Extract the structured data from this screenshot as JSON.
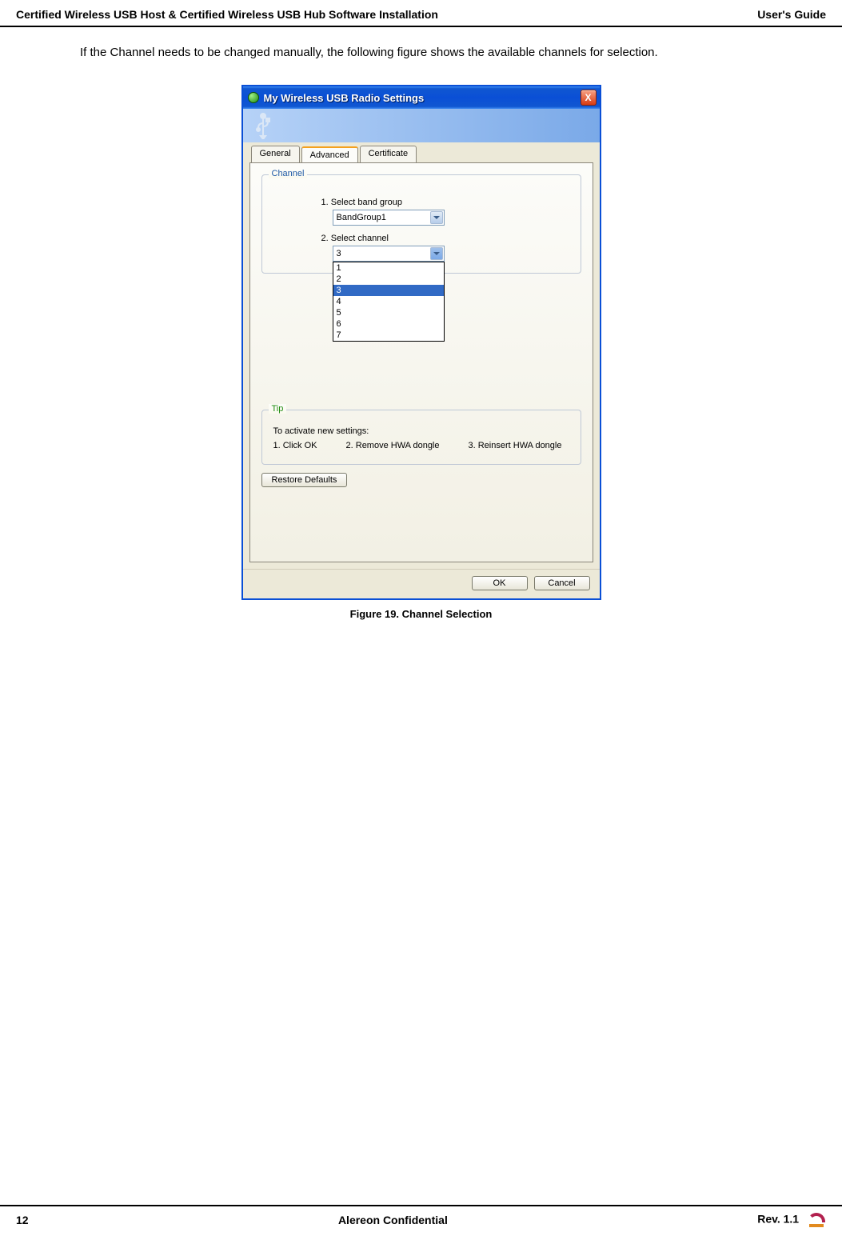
{
  "header": {
    "left": "Certified Wireless USB Host & Certified Wireless USB Hub Software Installation",
    "right": "User's Guide"
  },
  "body_text": "If the Channel needs to be changed manually, the following figure shows the available channels for selection.",
  "figure_caption": "Figure 19.    Channel Selection",
  "window": {
    "title": "My Wireless USB Radio Settings",
    "close_label": "X",
    "tabs": {
      "general": "General",
      "advanced": "Advanced",
      "certificate": "Certificate"
    },
    "channel_group": {
      "legend": "Channel",
      "band_label": "1. Select band group",
      "band_value": "BandGroup1",
      "channel_label": "2. Select channel",
      "channel_value": "3",
      "options": [
        "1",
        "2",
        "3",
        "4",
        "5",
        "6",
        "7"
      ],
      "selected_index": 2
    },
    "tip_group": {
      "legend": "Tip",
      "line1": "To activate new settings:",
      "step1": "1. Click OK",
      "step2": "2. Remove HWA dongle",
      "step3": "3. Reinsert HWA dongle"
    },
    "buttons": {
      "restore": "Restore Defaults",
      "ok": "OK",
      "cancel": "Cancel"
    }
  },
  "footer": {
    "page": "12",
    "center": "Alereon Confidential",
    "right": "Rev. 1.1"
  }
}
